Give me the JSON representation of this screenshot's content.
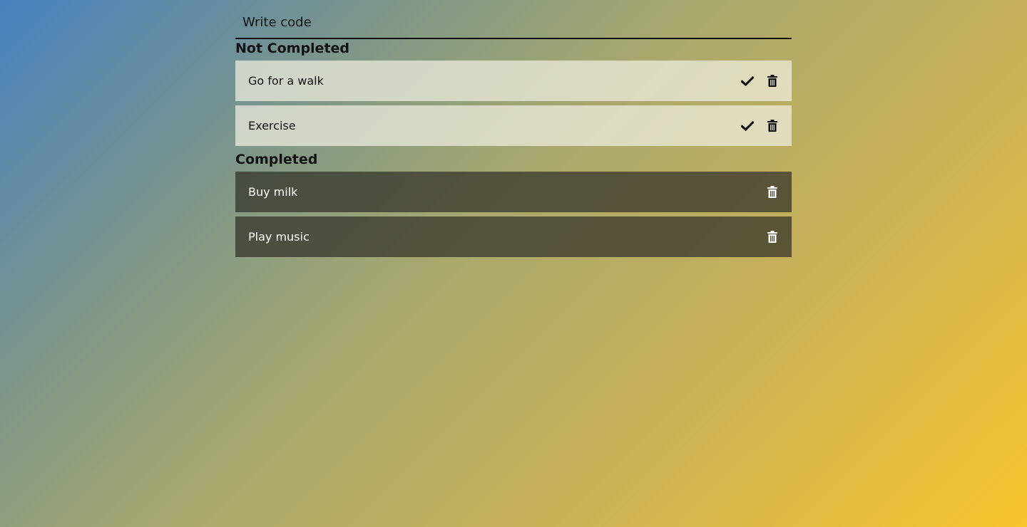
{
  "input": {
    "value": "Write code"
  },
  "sections": {
    "not_completed": {
      "heading": "Not Completed",
      "tasks": [
        {
          "label": "Go for a walk"
        },
        {
          "label": "Exercise"
        }
      ]
    },
    "completed": {
      "heading": "Completed",
      "tasks": [
        {
          "label": "Buy milk"
        },
        {
          "label": "Play music"
        }
      ]
    }
  },
  "icons": {
    "complete": "check-icon",
    "delete": "trash-icon"
  },
  "colors": {
    "pending_text": "#111111",
    "done_text": "#ffffff"
  }
}
